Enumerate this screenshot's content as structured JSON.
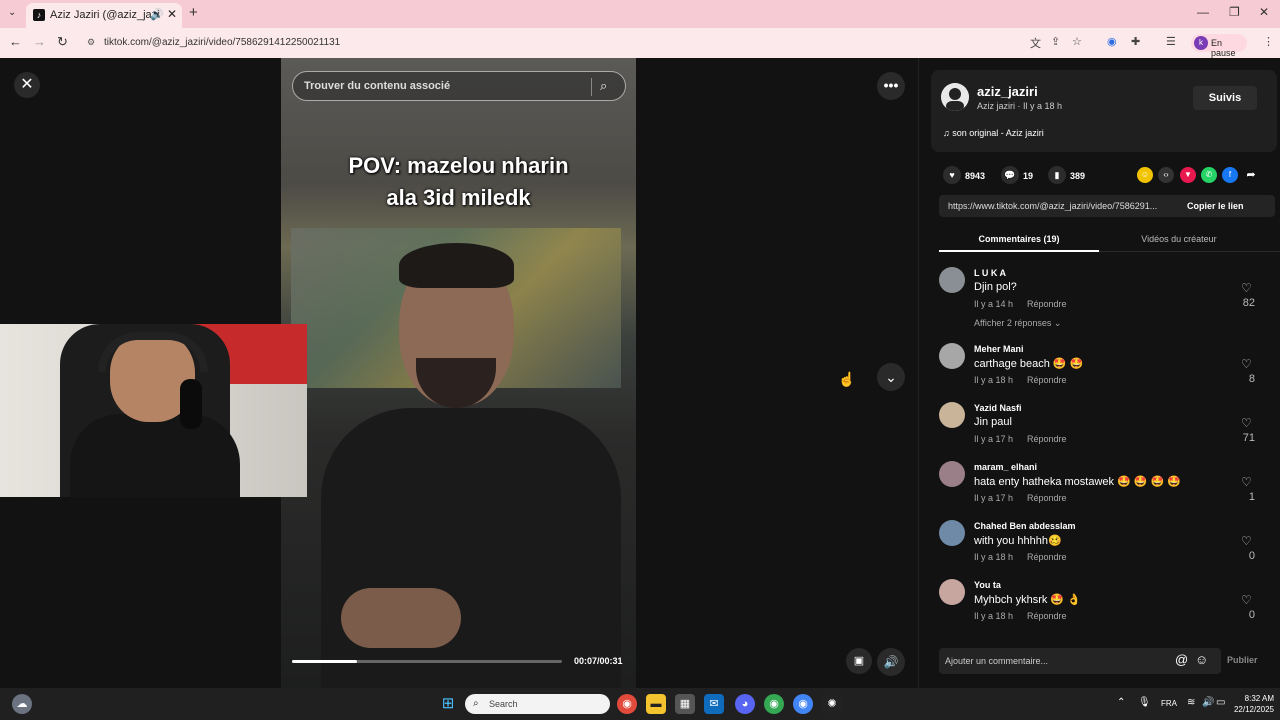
{
  "browser": {
    "tab_title": "Aziz Jaziri (@aziz_jaziri) | Tik",
    "url": "tiktok.com/@aziz_jaziri/video/7586291412250021131",
    "profile_label": "En pause",
    "profile_initial": "k"
  },
  "player": {
    "search_placeholder": "Trouver du contenu associé",
    "overlay_line1": "POV: mazelou nharin",
    "overlay_line2": "ala 3id miledk",
    "time": "00:07/00:31",
    "progress_fraction": 0.24
  },
  "author": {
    "username": "aziz_jaziri",
    "display_line": "Aziz jaziri · Il y a 18 h",
    "follow_label": "Suivis",
    "music": "son original - Aziz jaziri"
  },
  "stats": {
    "likes": "8943",
    "comments": "19",
    "saves": "389"
  },
  "link": {
    "url": "https://www.tiktok.com/@aziz_jaziri/video/7586291...",
    "copy_label": "Copier le lien"
  },
  "tabs": {
    "comments": "Commentaires (19)",
    "creator_videos": "Vidéos du créateur"
  },
  "comments": [
    {
      "name": "L U K A",
      "text": "Djin pol?",
      "time": "Il y a 14 h",
      "reply": "Répondre",
      "likes": "82",
      "more": "Afficher 2 réponses ⌄",
      "avatar_color": "#8a8f96"
    },
    {
      "name": "Meher Mani",
      "text": "carthage beach 🤩 🤩",
      "time": "Il y a 18 h",
      "reply": "Répondre",
      "likes": "8",
      "avatar_color": "#a7a7a7"
    },
    {
      "name": "Yazid Nasfi",
      "text": "Jin paul",
      "time": "Il y a 17 h",
      "reply": "Répondre",
      "likes": "71",
      "avatar_color": "#c9b49a"
    },
    {
      "name": "maram_ elhani",
      "text": "hata enty hatheka mostawek 🤩 🤩 🤩 🤩",
      "time": "Il y a 17 h",
      "reply": "Répondre",
      "likes": "1",
      "avatar_color": "#9a7f88"
    },
    {
      "name": "Chahed Ben abdesslam",
      "text": "with you hhhhh🥴",
      "time": "Il y a 18 h",
      "reply": "Répondre",
      "likes": "0",
      "avatar_color": "#6f8aa6"
    },
    {
      "name": "You ta",
      "text": "Myhbch ykhsrk 🤩 👌",
      "time": "Il y a 18 h",
      "reply": "Répondre",
      "likes": "0",
      "avatar_color": "#c7a6a0"
    }
  ],
  "composer": {
    "placeholder": "Ajouter un commentaire...",
    "publish": "Publier"
  },
  "taskbar": {
    "search": "Search",
    "lang": "FRA",
    "time": "8:32 AM",
    "date": "22/12/2025"
  }
}
